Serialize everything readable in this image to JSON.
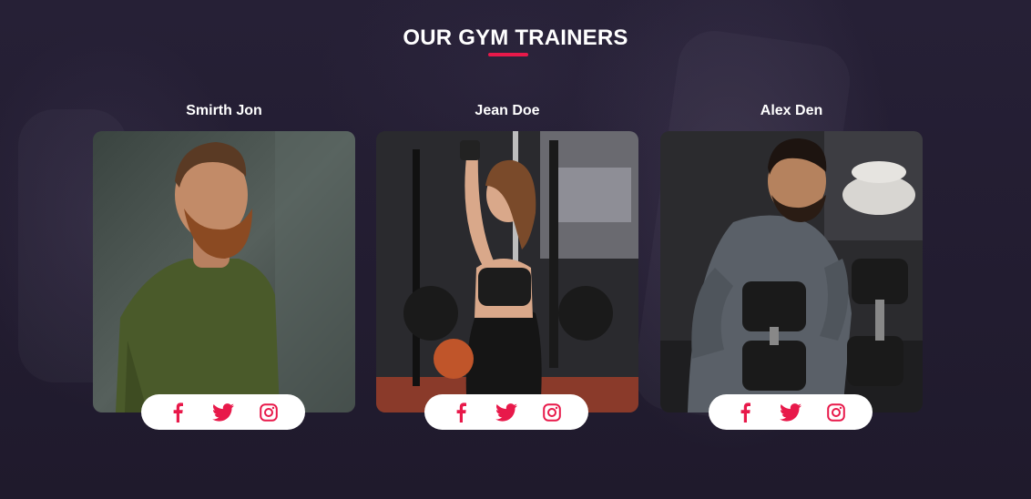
{
  "section": {
    "title": "OUR GYM TRAINERS",
    "accent_color": "#e8194a"
  },
  "trainers": [
    {
      "name": "Smirth Jon",
      "photo_subject": "bearded man in green t-shirt"
    },
    {
      "name": "Jean Doe",
      "photo_subject": "woman doing cable pulldown in gym"
    },
    {
      "name": "Alex Den",
      "photo_subject": "man lifting dumbbells"
    }
  ],
  "social": {
    "icons": [
      "facebook-icon",
      "twitter-icon",
      "instagram-icon"
    ],
    "icon_color": "#e8194a"
  },
  "colors": {
    "background": "#221d2f",
    "card_text": "#ffffff",
    "social_bar": "#ffffff"
  }
}
